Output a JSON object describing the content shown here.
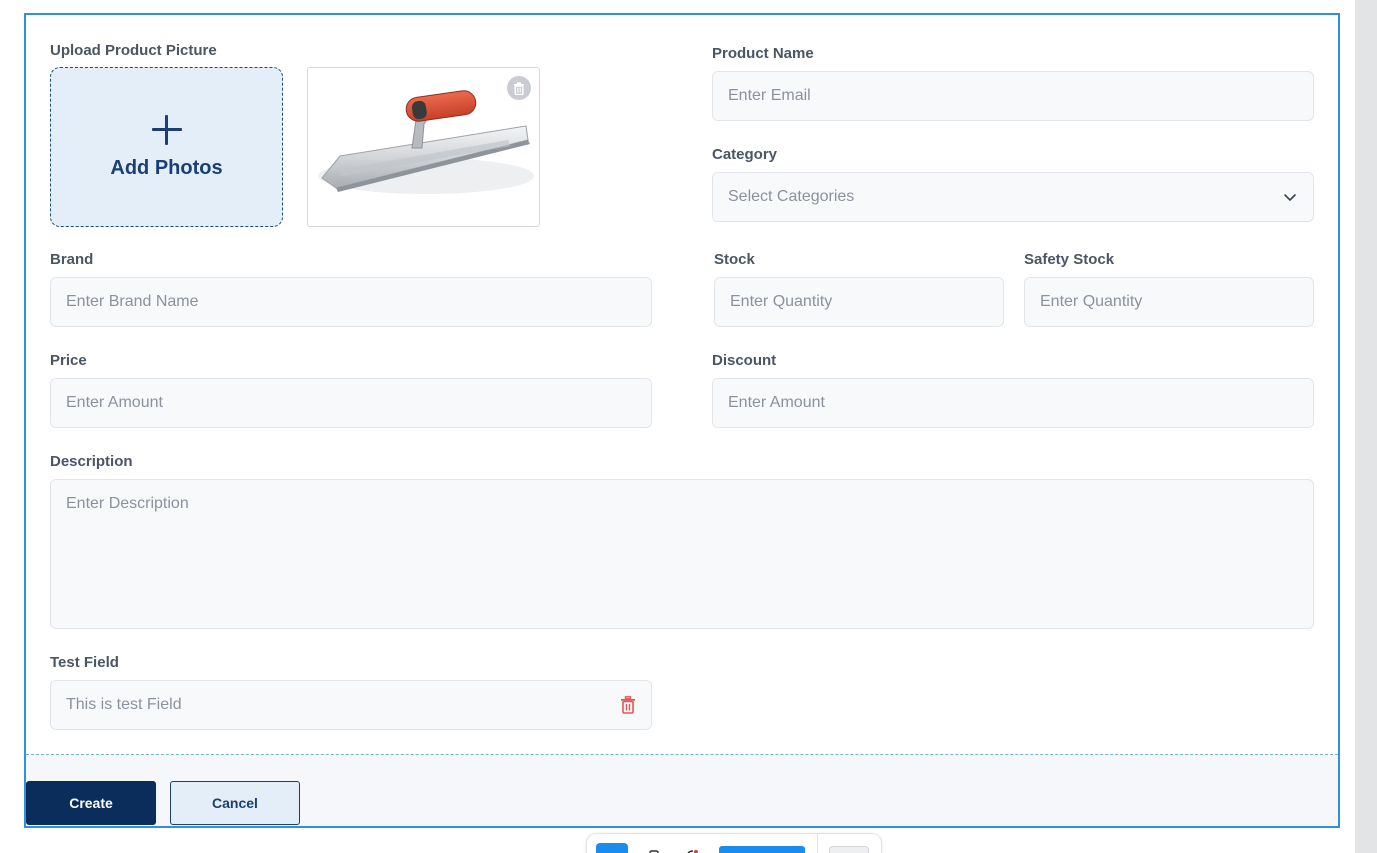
{
  "colors": {
    "frame_border": "#2f8fe0",
    "primary": "#0b2d5c",
    "upload_bg": "#e3eef9",
    "delete_red": "#e45757"
  },
  "upload": {
    "label": "Upload Product Picture",
    "add_photos_label": "Add Photos",
    "plus_icon": "plus-icon",
    "preview_alt": "trowel",
    "delete_icon": "trash-icon"
  },
  "product_name": {
    "label": "Product Name",
    "placeholder": "Enter Email"
  },
  "category": {
    "label": "Category",
    "placeholder": "Select Categories",
    "icon": "chevron-down-icon"
  },
  "brand": {
    "label": "Brand",
    "placeholder": "Enter Brand Name"
  },
  "stock": {
    "label": "Stock",
    "placeholder": "Enter Quantity"
  },
  "safety_stock": {
    "label": "Safety Stock",
    "placeholder": "Enter Quantity"
  },
  "price": {
    "label": "Price",
    "placeholder": "Enter Amount"
  },
  "discount": {
    "label": "Discount",
    "placeholder": "Enter Amount"
  },
  "description": {
    "label": "Description",
    "placeholder": "Enter Description"
  },
  "test_field": {
    "label": "Test Field",
    "placeholder": "This is test Field",
    "icon": "trash-icon"
  },
  "actions": {
    "create_label": "Create",
    "cancel_label": "Cancel"
  }
}
